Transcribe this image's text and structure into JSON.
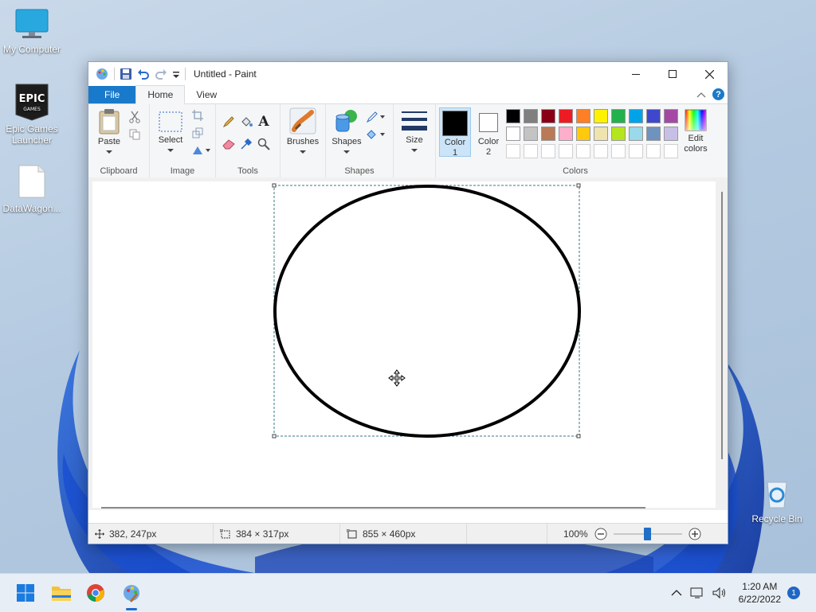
{
  "desktop": {
    "icons": [
      {
        "label": "My Computer"
      },
      {
        "label": "Epic Games Launcher"
      },
      {
        "label": "DataWagon..."
      },
      {
        "label": "Recycle Bin"
      }
    ]
  },
  "window": {
    "title": "Untitled - Paint",
    "tabs": {
      "file": "File",
      "home": "Home",
      "view": "View"
    },
    "ribbon": {
      "clipboard": {
        "group": "Clipboard",
        "paste": "Paste"
      },
      "image": {
        "group": "Image",
        "select": "Select"
      },
      "tools": {
        "group": "Tools",
        "text_tool": "A"
      },
      "brushes": {
        "label": "Brushes"
      },
      "shapes": {
        "group": "Shapes",
        "label": "Shapes"
      },
      "size": {
        "label": "Size"
      },
      "colors": {
        "group": "Colors",
        "color1_line1": "Color",
        "color1_line2": "1",
        "color2_line1": "Color",
        "color2_line2": "2",
        "edit_line1": "Edit",
        "edit_line2": "colors",
        "color1_value": "#000000",
        "color2_value": "#ffffff",
        "palette_row1": [
          "#000000",
          "#7f7f7f",
          "#880015",
          "#ed1c24",
          "#ff7f27",
          "#fff200",
          "#22b14c",
          "#00a2e8",
          "#3f48cc",
          "#a349a4"
        ],
        "palette_row2": [
          "#ffffff",
          "#c3c3c3",
          "#b97a57",
          "#ffaec9",
          "#ffc90e",
          "#efe4b0",
          "#b5e61d",
          "#99d9ea",
          "#7092be",
          "#c8bfe7"
        ]
      },
      "help": "?"
    },
    "status": {
      "cursor_pos": "382, 247px",
      "selection_size": "384 × 317px",
      "image_size": "855 × 460px",
      "zoom": "100%",
      "zoom_level_fraction": 0.5
    }
  },
  "taskbar": {
    "time": "1:20 AM",
    "date": "6/22/2022",
    "notifications": "1"
  }
}
